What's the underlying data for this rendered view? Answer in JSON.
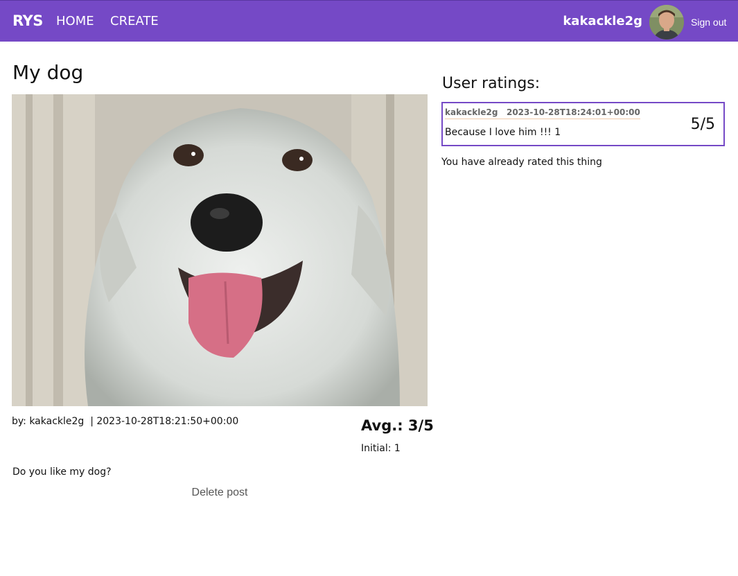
{
  "nav": {
    "brand": "RYS",
    "home": "HOME",
    "create": "CREATE",
    "username": "kakackle2g",
    "signout": "Sign out",
    "accent_color": "#7549c6"
  },
  "post": {
    "title": "My dog",
    "byline": "by: kakackle2g  | 2023-10-28T18:21:50+00:00",
    "average": "Avg.: 3/5",
    "initial": "Initial: 1",
    "description": "Do you like my dog?",
    "delete_label": "Delete post"
  },
  "ratings": {
    "title": "User ratings:",
    "items": [
      {
        "meta": "kakackle2g   2023-10-28T18:24:01+00:00",
        "text": "Because I love him !!! 1",
        "score": "5/5"
      }
    ],
    "already_rated": "You have already rated this thing"
  }
}
